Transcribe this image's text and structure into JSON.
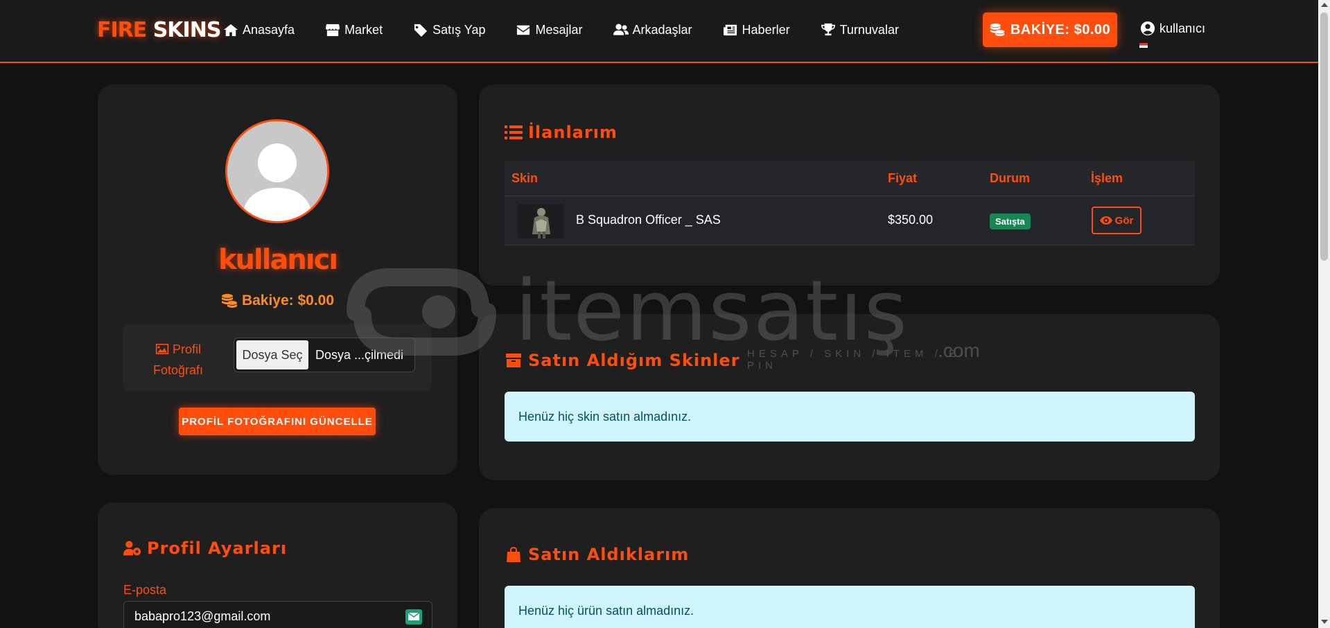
{
  "brand": {
    "part1": "FIRE",
    "part2": "SKINS"
  },
  "nav": [
    {
      "label": "Anasayfa",
      "icon": "home-icon"
    },
    {
      "label": "Market",
      "icon": "store-icon"
    },
    {
      "label": "Satış Yap",
      "icon": "tag-icon"
    },
    {
      "label": "Mesajlar",
      "icon": "envelope-icon"
    },
    {
      "label": "Arkadaşlar",
      "icon": "users-icon"
    },
    {
      "label": "Haberler",
      "icon": "newspaper-icon"
    },
    {
      "label": "Turnuvalar",
      "icon": "trophy-icon"
    }
  ],
  "header": {
    "balance_label": "BAKİYE: $0.00",
    "username": "kullanıcı"
  },
  "profile": {
    "username": "kullanıcı",
    "balance": "Bakiye: $0.00",
    "photo_label_line1": "Profil",
    "photo_label_line2": "Fotoğrafı",
    "file_button": "Dosya Seç",
    "file_status": "Dosya ...çilmedi",
    "update_button": "PROFİL FOTOĞRAFINI GÜNCELLE"
  },
  "listings": {
    "title": "İlanlarım",
    "columns": [
      "Skin",
      "Fiyat",
      "Durum",
      "İşlem"
    ],
    "rows": [
      {
        "name": "B Squadron Officer _ SAS",
        "price": "$350.00",
        "status": "Satışta",
        "action": "Gör"
      }
    ]
  },
  "purchased_skins": {
    "title": "Satın Aldığım Skinler",
    "empty_message": "Henüz hiç skin satın almadınız."
  },
  "settings": {
    "title": "Profil Ayarları",
    "email_label": "E-posta",
    "email_value": "babapro123@gmail.com"
  },
  "purchases": {
    "title": "Satın Aldıklarım",
    "empty_message": "Henüz hiç ürün satın almadınız."
  },
  "watermark": {
    "text": "itemsatış",
    "tagline": "HESAP / SKIN / ITEM / E-PIN",
    "domain": ".com"
  },
  "colors": {
    "accent": "#ff4d0d",
    "card": "#1f1f1f",
    "background": "#121212",
    "success": "#198754",
    "info_bg": "#cff4fc"
  }
}
